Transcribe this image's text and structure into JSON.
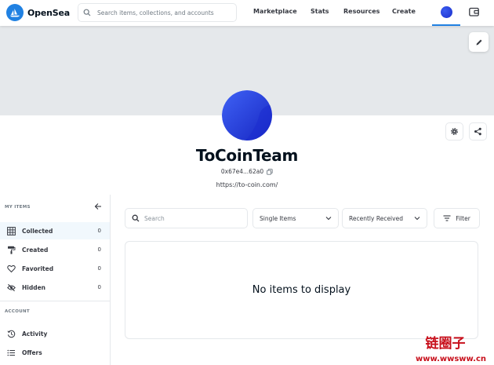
{
  "nav": {
    "brand": "OpenSea",
    "search_placeholder": "Search items, collections, and accounts",
    "links": [
      "Marketplace",
      "Stats",
      "Resources",
      "Create"
    ]
  },
  "profile": {
    "name": "ToCoinTeam",
    "address": "0x67e4...62a0",
    "website": "https://to-coin.com/"
  },
  "sidebar": {
    "my_items_label": "MY ITEMS",
    "items": [
      {
        "label": "Collected",
        "count": "0"
      },
      {
        "label": "Created",
        "count": "0"
      },
      {
        "label": "Favorited",
        "count": "0"
      },
      {
        "label": "Hidden",
        "count": "0"
      }
    ],
    "account_label": "ACCOUNT",
    "account_items": [
      {
        "label": "Activity"
      },
      {
        "label": "Offers"
      }
    ]
  },
  "filters": {
    "search_placeholder": "Search",
    "item_type": "Single Items",
    "sort": "Recently Received",
    "filter_label": "Filter"
  },
  "empty_message": "No items to display",
  "watermark": {
    "title": "链圈子",
    "url": "www.wwsww.cn"
  },
  "colors": {
    "accent": "#2081e2",
    "banner": "#e5e8eb",
    "active_bg": "#f1f8fd",
    "avatar": "#2a3ee0"
  }
}
